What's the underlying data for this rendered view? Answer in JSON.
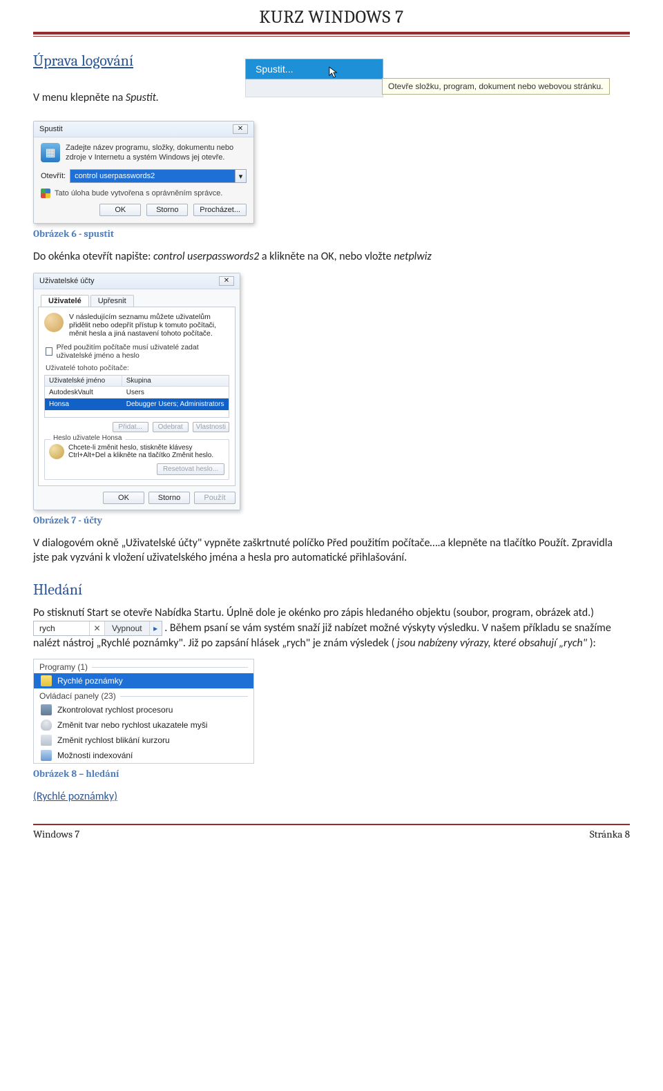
{
  "page": {
    "title": "KURZ WINDOWS 7",
    "footer_left": "Windows 7",
    "footer_right": "Stránka 8"
  },
  "section1": {
    "heading": "Úprava logování",
    "para1_a": "V menu klepněte na ",
    "para1_b": "Spustit.",
    "menu_item": "Spustit...",
    "tooltip": "Otevře složku, program, dokument nebo webovou stránku."
  },
  "run": {
    "title": "Spustit",
    "desc": "Zadejte název programu, složky, dokumentu nebo zdroje v Internetu a systém Windows jej otevře.",
    "open_label": "Otevřít:",
    "value": "control userpasswords2",
    "uac": "Tato úloha bude vytvořena s oprávněním správce.",
    "ok": "OK",
    "cancel": "Storno",
    "browse": "Procházet..."
  },
  "caption_run": "Obrázek 6 - spustit",
  "para_after_run_a": "Do okénka otevřít napište: ",
  "para_after_run_b": "control userpasswords2",
  "para_after_run_c": " a klikněte na OK, nebo vložte ",
  "para_after_run_d": "netplwiz",
  "ua": {
    "title": "Uživatelské účty",
    "tab1": "Uživatelé",
    "tab2": "Upřesnit",
    "blurb": "V následujícím seznamu můžete uživatelům přidělit nebo odepřít přístup k tomuto počítači, měnit hesla a jiná nastavení tohoto počítače.",
    "check_label": "Před použitím počítače musí uživatelé zadat uživatelské jméno a heslo",
    "list_label": "Uživatelé tohoto počítače:",
    "col1": "Uživatelské jméno",
    "col2": "Skupina",
    "row1_name": "AutodeskVault",
    "row1_group": "Users",
    "row2_name": "Honsa",
    "row2_group": "Debugger Users; Administrators",
    "btn_add": "Přidat...",
    "btn_remove": "Odebrat",
    "btn_props": "Vlastnosti",
    "pwd_label": "Heslo uživatele Honsa",
    "pwd_text": "Chcete-li změnit heslo, stiskněte klávesy Ctrl+Alt+Del a klikněte na tlačítko Změnit heslo.",
    "pwd_btn": "Resetovat heslo...",
    "ok": "OK",
    "cancel": "Storno",
    "apply": "Použít"
  },
  "caption_ua": "Obrázek 7 - účty",
  "para_ua1": "V dialogovém okně „Uživatelské účty\" vypněte zaškrtnuté políčko Před použitím počítače….a klepněte na tlačítko Použít. Zpravidla jste pak vyzváni k vložení uživatelského jména a hesla pro automatické přihlašování.",
  "section2": {
    "heading": "Hledání",
    "para_a": "Po stisknutí Start se otevře Nabídka Startu. Úplně dole je okénko pro zápis hledaného objektu (soubor, program, obrázek atd.) ",
    "search_value": "rych",
    "search_label": "Vypnout",
    "para_b": ". Během psaní se vám systém snaží již nabízet možné výskyty výsledku. V našem příkladu se snažíme nalézt nástroj „Rychlé poznámky\". Již po zapsání hlásek „rych\" je znám výsledek (",
    "para_c": "jsou nabízeny výrazy, které obsahují „rych\"",
    "para_d": "):"
  },
  "results": {
    "hdr1": "Programy (1)",
    "item1": "Rychlé poznámky",
    "hdr2": "Ovládací panely (23)",
    "item2": "Zkontrolovat rychlost procesoru",
    "item3": "Změnit tvar nebo rychlost ukazatele myši",
    "item4": "Změnit rychlost blikání kurzoru",
    "item5": "Možnosti indexování"
  },
  "caption_results": "Obrázek 8 – hledání",
  "link": "(Rychlé poznámky)"
}
